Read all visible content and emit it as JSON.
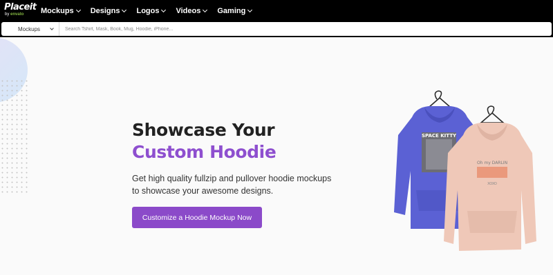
{
  "header": {
    "logo": {
      "main": "Placeit",
      "by": "by",
      "brand": "envato"
    },
    "nav": [
      {
        "label": "Mockups"
      },
      {
        "label": "Designs"
      },
      {
        "label": "Logos"
      },
      {
        "label": "Videos"
      },
      {
        "label": "Gaming"
      }
    ]
  },
  "search": {
    "category": "Mockups",
    "placeholder": "Search Tshirt, Mask, Book, Mug, Hoodie, iPhone..."
  },
  "hero": {
    "title_line1": "Showcase Your",
    "title_line2": "Custom Hoodie",
    "subtitle": "Get high quality fullzip and pullover hoodie mockups to showcase your awesome designs.",
    "cta_label": "Customize a Hoodie Mockup Now",
    "image": {
      "blue_hoodie_print": "SPACE KITTY",
      "pink_hoodie_print": "Oh my DARLIN",
      "pink_hoodie_sub": "XOXO"
    }
  },
  "colors": {
    "accent": "#8b4ac9",
    "headline_purple": "#8e4fcf",
    "topbar": "#000000",
    "blue_hoodie": "#5b61d4",
    "pink_hoodie": "#efc8b8"
  }
}
